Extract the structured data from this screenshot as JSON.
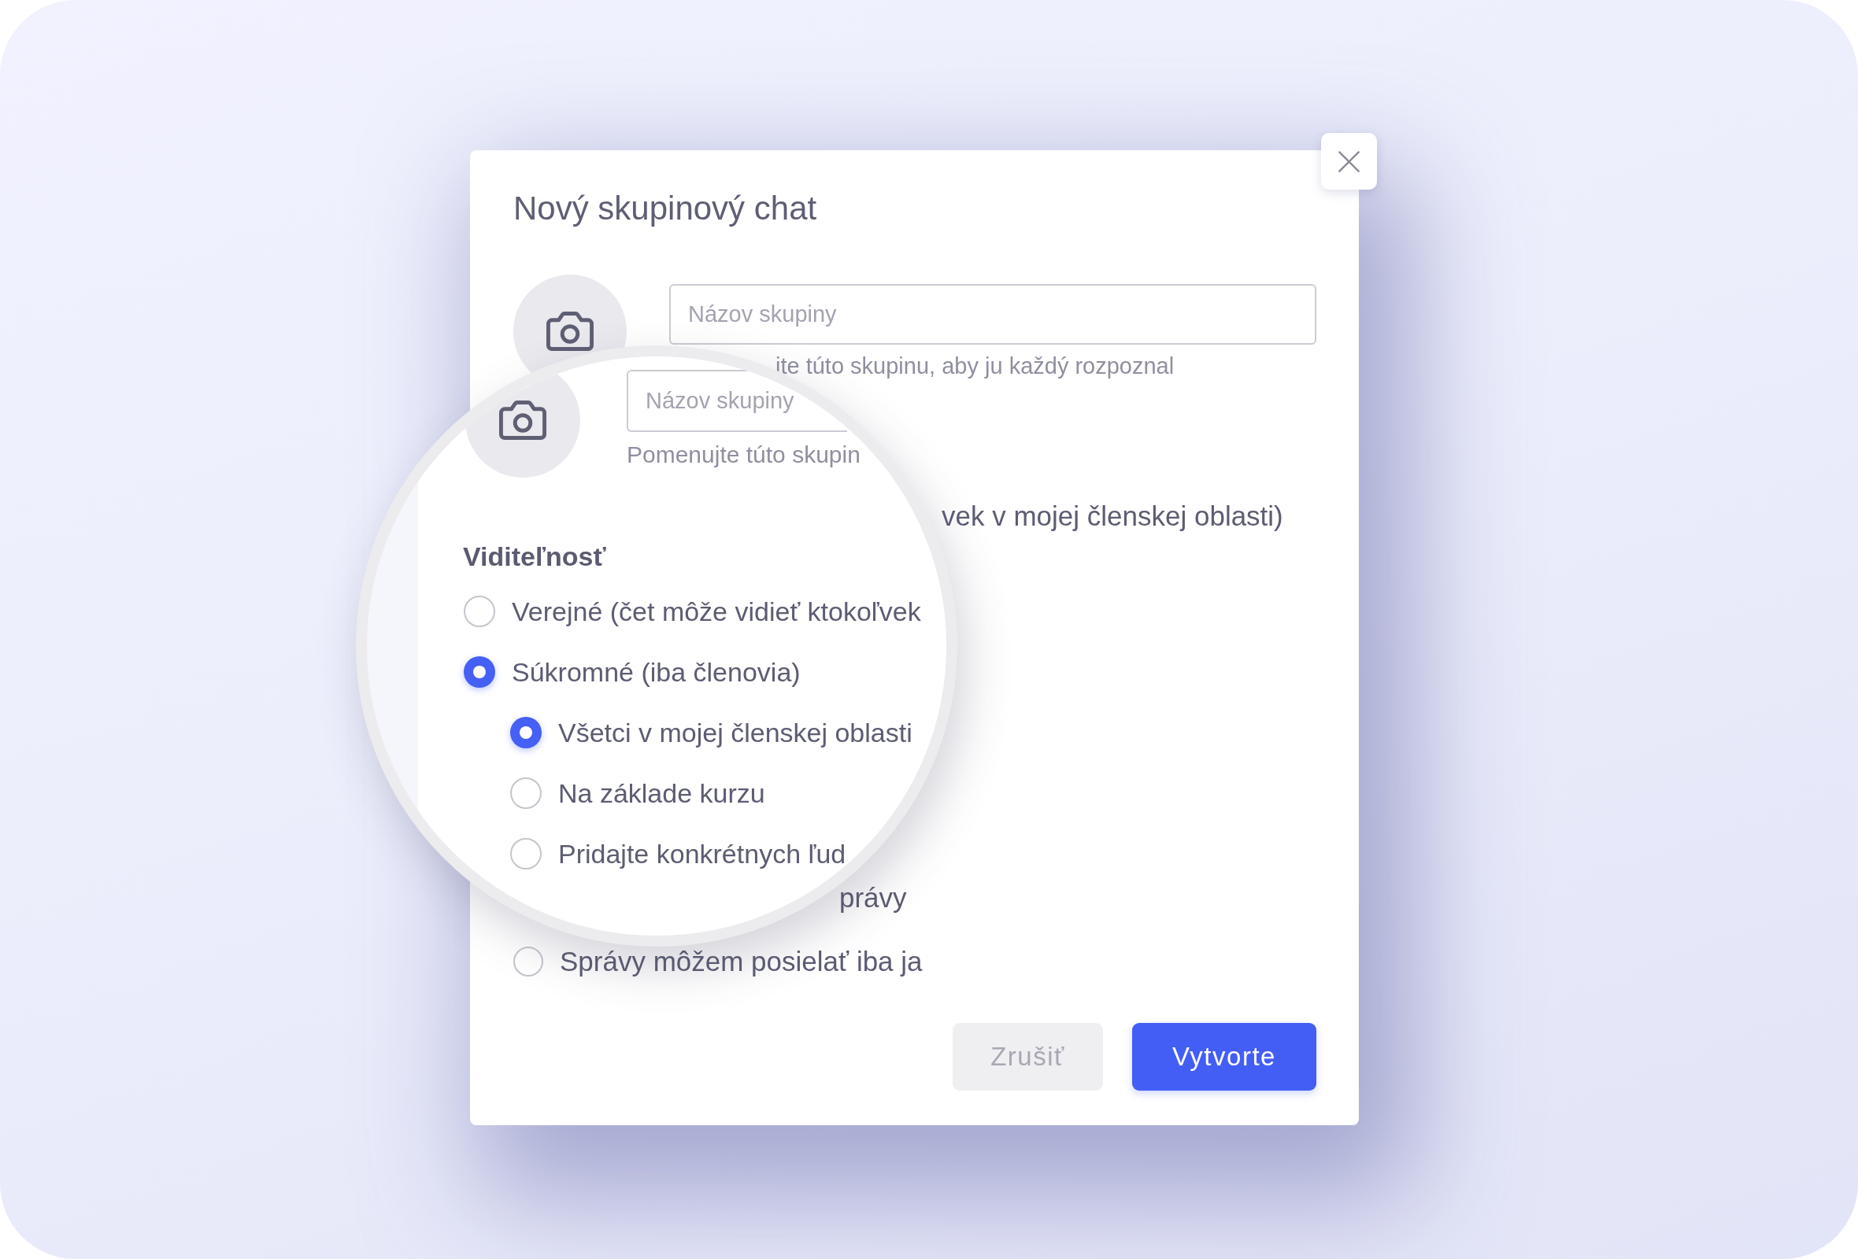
{
  "dialog": {
    "title": "Nový skupinový chat",
    "group_name_field": {
      "placeholder": "Názov skupiny"
    },
    "helper_text": "ite túto skupinu, aby ju každý rozpoznal",
    "partial_lines": [
      "vek v mojej členskej oblasti)",
      "právy"
    ],
    "message_options": [
      {
        "label": "Správy môžem posielať iba ja",
        "selected": false
      }
    ],
    "buttons": [
      {
        "label": "Zrušiť",
        "kind": "secondary"
      },
      {
        "label": "Vytvorte",
        "kind": "primary"
      }
    ]
  },
  "magnifier": {
    "group_name_field": {
      "placeholder": "Názov skupiny"
    },
    "helper_text": "Pomenujte túto skupin",
    "visibility": {
      "heading": "Viditeľnosť",
      "options": [
        {
          "label": "Verejné (čet môže vidieť ktokoľvek",
          "selected": false
        },
        {
          "label": "Súkromné (iba členovia)",
          "selected": true,
          "children": [
            {
              "label": "Všetci v mojej členskej oblasti",
              "selected": true
            },
            {
              "label": "Na základe kurzu",
              "selected": false
            },
            {
              "label": "Pridajte konkrétnych ľud",
              "selected": false
            }
          ]
        }
      ]
    }
  }
}
